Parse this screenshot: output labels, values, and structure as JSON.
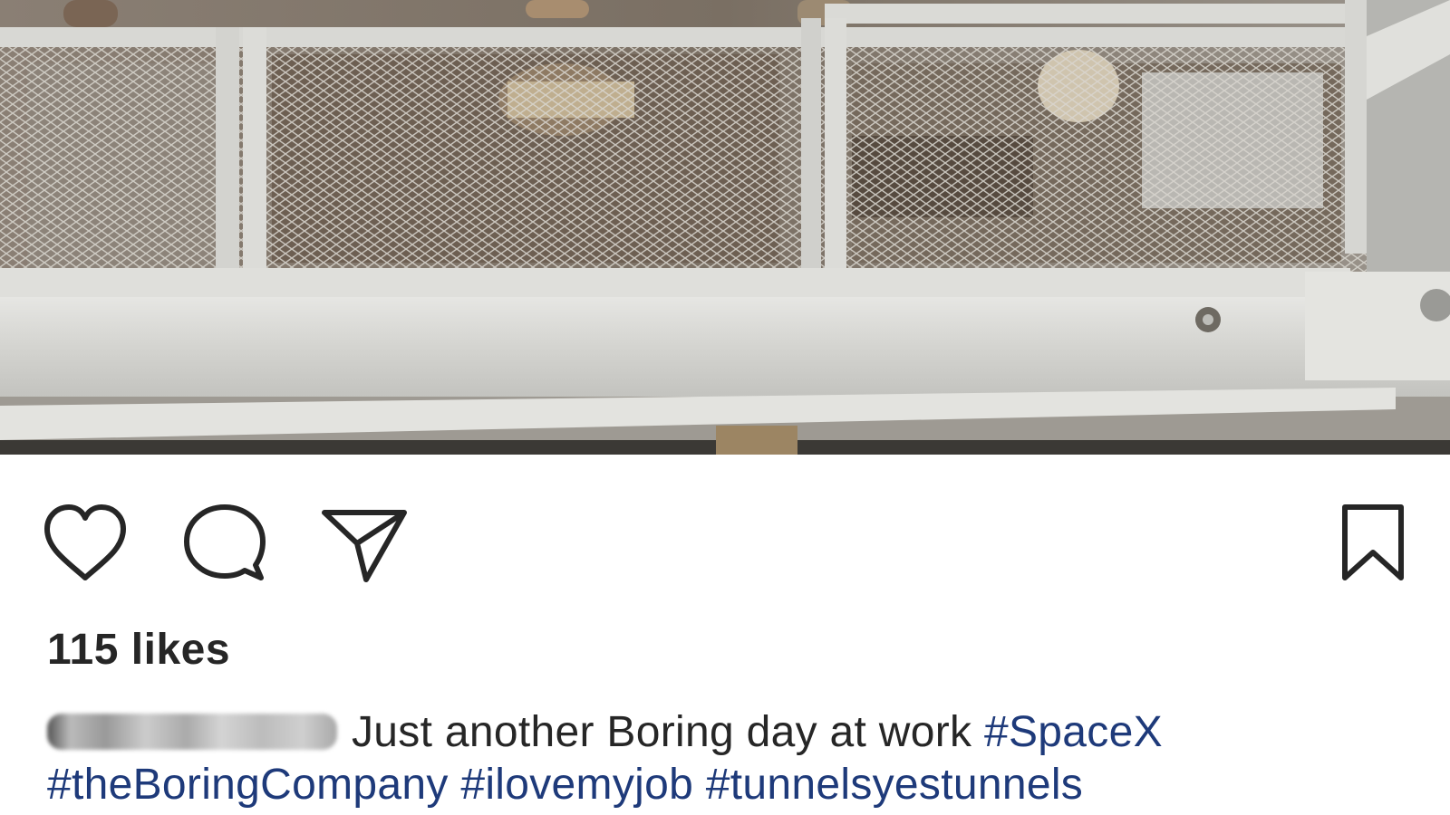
{
  "post": {
    "photo_alt": "",
    "likes_text": "115 likes",
    "caption_text": "Just another Boring day at work",
    "hashtags": [
      "#SpaceX",
      "#theBoringCompany",
      "#ilovemyjob",
      "#tunnelsyestunnels"
    ]
  },
  "actions": {
    "like_icon": "heart-icon",
    "comment_icon": "comment-icon",
    "share_icon": "paper-plane-icon",
    "save_icon": "bookmark-icon"
  },
  "colors": {
    "text": "#262626",
    "hashtag": "#1e3a7a",
    "background": "#ffffff"
  }
}
